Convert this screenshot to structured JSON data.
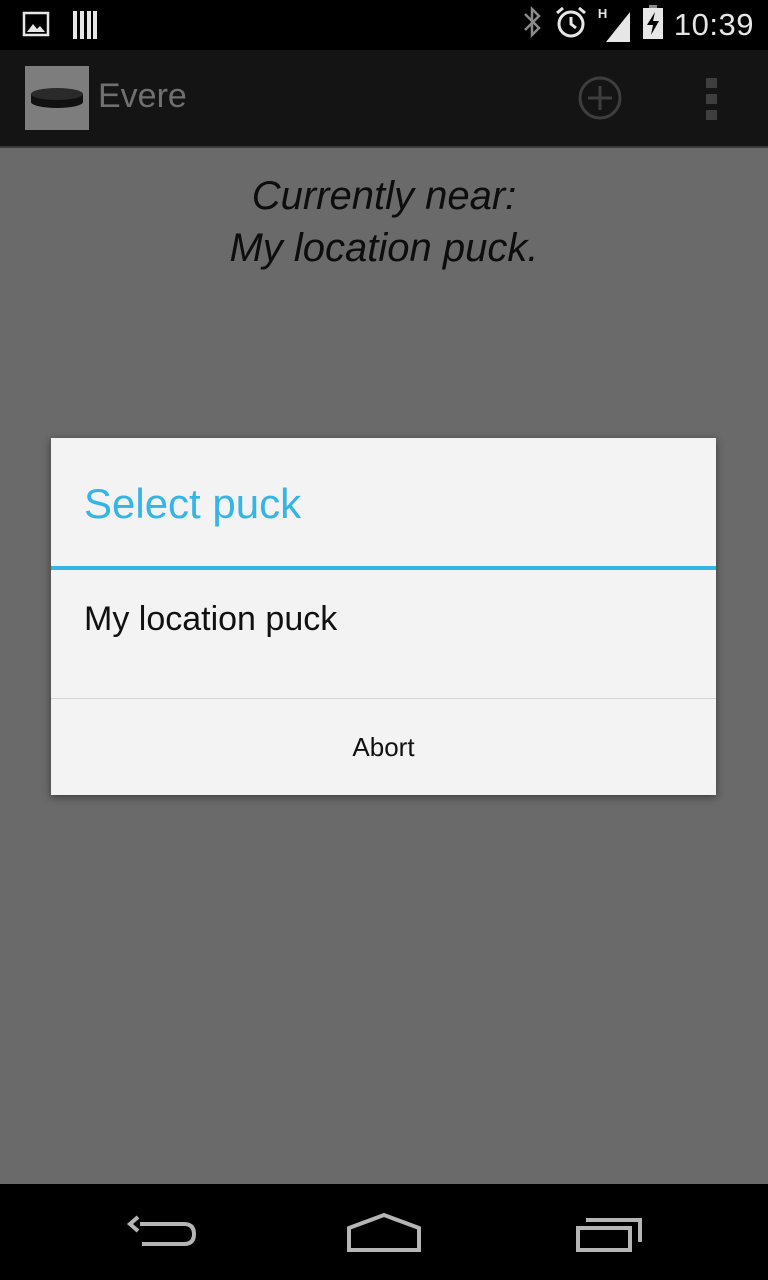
{
  "status_bar": {
    "time": "10:39",
    "network_type": "H",
    "left_icons": [
      "image-icon",
      "barcode-icon"
    ],
    "right_icons": [
      "bluetooth-icon",
      "alarm-icon",
      "signal-icon",
      "battery-charging-icon"
    ]
  },
  "action_bar": {
    "title": "Evere",
    "actions": [
      "add-icon",
      "overflow-menu-icon"
    ]
  },
  "content": {
    "line1": "Currently near:",
    "line2": "My location puck."
  },
  "dialog": {
    "title": "Select puck",
    "items": [
      "My location puck"
    ],
    "button": "Abort",
    "accent_color": "#33b5e5"
  },
  "nav_bar": {
    "buttons": [
      "back-icon",
      "home-icon",
      "recent-apps-icon"
    ]
  }
}
